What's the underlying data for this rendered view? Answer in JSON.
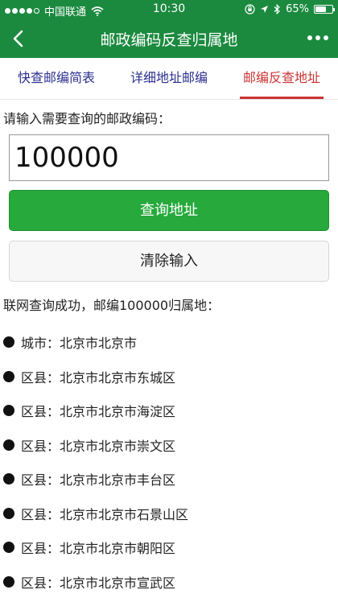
{
  "status": {
    "carrier": "中国联通",
    "time": "10:30",
    "battery": "65%",
    "battery_level": 0.65
  },
  "nav": {
    "title": "邮政编码反查归属地"
  },
  "tabs": [
    {
      "label": "快查邮编简表"
    },
    {
      "label": "详细地址邮编"
    },
    {
      "label": "邮编反查地址"
    }
  ],
  "form": {
    "prompt": "请输入需要查询的邮政编码：",
    "code_value": "100000",
    "query_button": "查询地址",
    "clear_button": "清除输入"
  },
  "result": {
    "message": "联网查询成功，邮编100000归属地：",
    "items": [
      "城市：北京市北京市",
      "区县：北京市北京市东城区",
      "区县：北京市北京市海淀区",
      "区县：北京市北京市崇文区",
      "区县：北京市北京市丰台区",
      "区县：北京市北京市石景山区",
      "区县：北京市北京市朝阳区",
      "区县：北京市北京市宣武区"
    ]
  }
}
